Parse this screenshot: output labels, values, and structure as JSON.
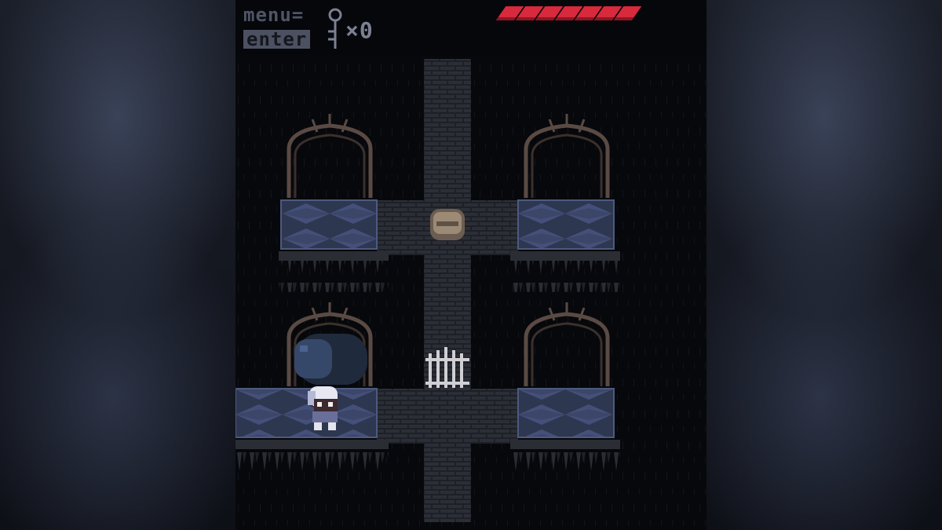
{
  "hud": {
    "menu_label": "menu=",
    "enter_label": "enter",
    "key_count": "×0",
    "health_segments": 7
  },
  "colors": {
    "health": "#d8293d",
    "hud_text": "#4f5568",
    "tile_floor": "#3b4663",
    "brick": "#24272e"
  },
  "scene": {
    "objects": [
      "gothic-arch",
      "gothic-arch",
      "gothic-arch",
      "gothic-arch",
      "boulder",
      "iron-gate",
      "player",
      "blue-slime"
    ]
  }
}
